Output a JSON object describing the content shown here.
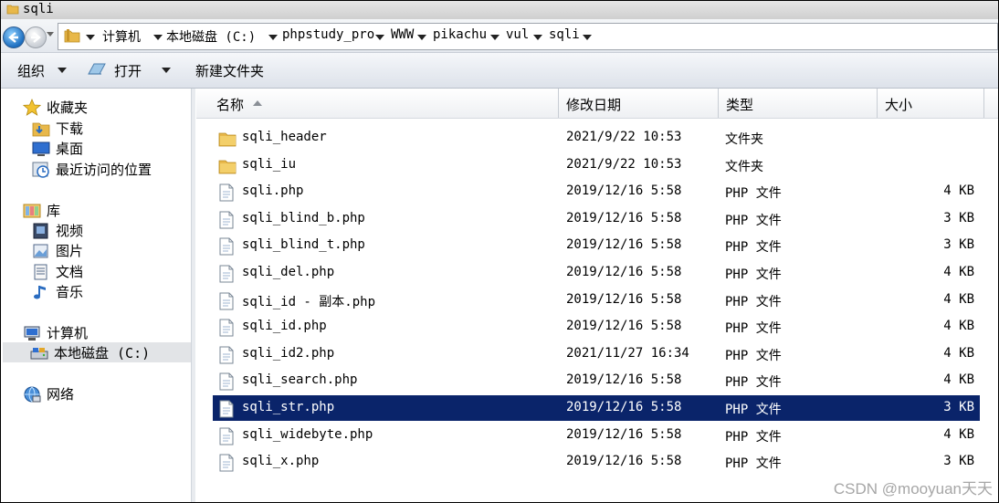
{
  "window": {
    "title": "sqli"
  },
  "address": {
    "crumbs": [
      "计算机",
      "本地磁盘 (C:)",
      "phpstudy_pro",
      "WWW",
      "pikachu",
      "vul",
      "sqli"
    ]
  },
  "toolbar": {
    "organize": "组织",
    "open": "打开",
    "new_folder": "新建文件夹"
  },
  "nav": {
    "favorites": "收藏夹",
    "downloads": "下载",
    "desktop": "桌面",
    "recent": "最近访问的位置",
    "libraries": "库",
    "videos": "视频",
    "pictures": "图片",
    "documents": "文档",
    "music": "音乐",
    "computer": "计算机",
    "local_disk": "本地磁盘 (C:)",
    "network": "网络"
  },
  "columns": {
    "name": "名称",
    "date": "修改日期",
    "type": "类型",
    "size": "大小"
  },
  "files": [
    {
      "name": "sqli_header",
      "date": "2021/9/22 10:53",
      "type": "文件夹",
      "size": "",
      "kind": "folder"
    },
    {
      "name": "sqli_iu",
      "date": "2021/9/22 10:53",
      "type": "文件夹",
      "size": "",
      "kind": "folder"
    },
    {
      "name": "sqli.php",
      "date": "2019/12/16 5:58",
      "type": "PHP 文件",
      "size": "4 KB",
      "kind": "file"
    },
    {
      "name": "sqli_blind_b.php",
      "date": "2019/12/16 5:58",
      "type": "PHP 文件",
      "size": "3 KB",
      "kind": "file"
    },
    {
      "name": "sqli_blind_t.php",
      "date": "2019/12/16 5:58",
      "type": "PHP 文件",
      "size": "3 KB",
      "kind": "file"
    },
    {
      "name": "sqli_del.php",
      "date": "2019/12/16 5:58",
      "type": "PHP 文件",
      "size": "4 KB",
      "kind": "file"
    },
    {
      "name": "sqli_id - 副本.php",
      "date": "2019/12/16 5:58",
      "type": "PHP 文件",
      "size": "4 KB",
      "kind": "file"
    },
    {
      "name": "sqli_id.php",
      "date": "2019/12/16 5:58",
      "type": "PHP 文件",
      "size": "4 KB",
      "kind": "file"
    },
    {
      "name": "sqli_id2.php",
      "date": "2021/11/27 16:34",
      "type": "PHP 文件",
      "size": "4 KB",
      "kind": "file"
    },
    {
      "name": "sqli_search.php",
      "date": "2019/12/16 5:58",
      "type": "PHP 文件",
      "size": "4 KB",
      "kind": "file"
    },
    {
      "name": "sqli_str.php",
      "date": "2019/12/16 5:58",
      "type": "PHP 文件",
      "size": "3 KB",
      "kind": "file"
    },
    {
      "name": "sqli_widebyte.php",
      "date": "2019/12/16 5:58",
      "type": "PHP 文件",
      "size": "4 KB",
      "kind": "file"
    },
    {
      "name": "sqli_x.php",
      "date": "2019/12/16 5:58",
      "type": "PHP 文件",
      "size": "3 KB",
      "kind": "file"
    }
  ],
  "selected_file": "sqli_str.php",
  "watermark": "CSDN @mooyuan天天",
  "colors": {
    "selection": "#0a246a",
    "folder": "#e8b84a",
    "link_blue": "#1e6fc0"
  }
}
